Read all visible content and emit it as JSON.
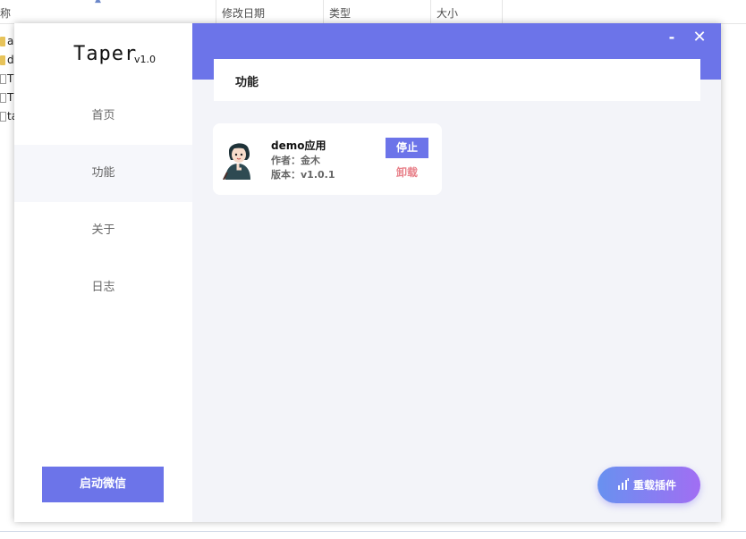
{
  "explorer": {
    "columns": {
      "name": "称",
      "date": "修改日期",
      "type": "类型",
      "size": "大小"
    },
    "files": [
      {
        "text": "a",
        "icon": "folder"
      },
      {
        "text": "d",
        "icon": "folder"
      },
      {
        "text": "T",
        "icon": "doc"
      },
      {
        "text": "T",
        "icon": "doc"
      },
      {
        "text": "ta",
        "icon": "doc"
      }
    ]
  },
  "app": {
    "logo": "Taper",
    "version": "v1.0",
    "nav": [
      {
        "label": "首页"
      },
      {
        "label": "功能"
      },
      {
        "label": "关于"
      },
      {
        "label": "日志"
      }
    ],
    "active_nav": "功能",
    "start_button": "启动微信",
    "window_controls": {
      "minimize": "-",
      "close": "✕"
    },
    "section_title": "功能",
    "plugin": {
      "name": "demo应用",
      "author": "作者：金木",
      "version": "版本：v1.0.1",
      "stop_label": "停止",
      "uninstall_label": "卸载"
    },
    "reload_button": "重载插件",
    "colors": {
      "accent": "#6c74e9",
      "danger_text": "#e8818a",
      "gradient_start": "#6891f0",
      "gradient_end": "#a16ef3"
    }
  }
}
